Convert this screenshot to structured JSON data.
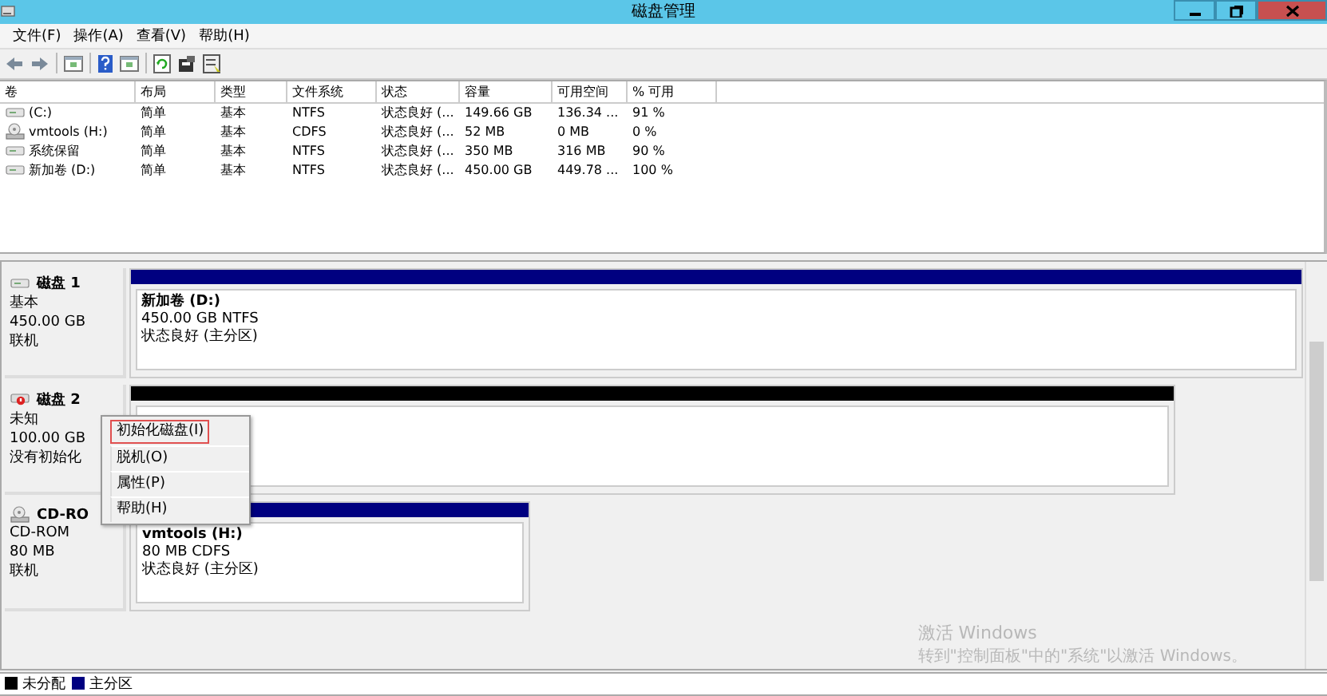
{
  "window": {
    "title": "磁盘管理"
  },
  "menu": [
    "文件(F)",
    "操作(A)",
    "查看(V)",
    "帮助(H)"
  ],
  "toolbar": [
    {
      "kind": "back"
    },
    {
      "kind": "forward"
    },
    {
      "kind": "sep"
    },
    {
      "kind": "panel"
    },
    {
      "kind": "sep"
    },
    {
      "kind": "help"
    },
    {
      "kind": "panel"
    },
    {
      "kind": "sep"
    },
    {
      "kind": "refresh"
    },
    {
      "kind": "properties"
    },
    {
      "kind": "wizard"
    }
  ],
  "volume_table": {
    "columns": [
      "卷",
      "布局",
      "类型",
      "文件系统",
      "状态",
      "容量",
      "可用空间",
      "% 可用"
    ],
    "rows": [
      {
        "kind": "disk",
        "cells": [
          "(C:)",
          "简单",
          "基本",
          "NTFS",
          "状态良好 (...",
          "149.66 GB",
          "136.34 ...",
          "91 %"
        ]
      },
      {
        "kind": "cdrom",
        "cells": [
          "vmtools (H:)",
          "简单",
          "基本",
          "CDFS",
          "状态良好 (...",
          "52 MB",
          "0 MB",
          "0 %"
        ]
      },
      {
        "kind": "disk",
        "cells": [
          "系统保留",
          "简单",
          "基本",
          "NTFS",
          "状态良好 (...",
          "350 MB",
          "316 MB",
          "90 %"
        ]
      },
      {
        "kind": "disk",
        "cells": [
          "新加卷 (D:)",
          "简单",
          "基本",
          "NTFS",
          "状态良好 (...",
          "450.00 GB",
          "449.78 ...",
          "100 %"
        ]
      }
    ]
  },
  "disks": [
    {
      "kind": "basic",
      "name": "磁盘 1",
      "lines": [
        "基本",
        "450.00 GB",
        "联机"
      ],
      "partition": {
        "kind": "primary",
        "title": "新加卷  (D:)",
        "lines": [
          "450.00 GB NTFS",
          "状态良好 (主分区)"
        ]
      }
    },
    {
      "kind": "unknown",
      "name": "磁盘 2",
      "lines": [
        "未知",
        "100.00 GB",
        "没有初始化"
      ],
      "partition": {
        "kind": "unallocated"
      }
    },
    {
      "kind": "cdrom",
      "name": "CD-RO",
      "lines": [
        "CD-ROM",
        "80 MB",
        "联机"
      ],
      "partition": {
        "kind": "primary",
        "title": "vmtools  (H:)",
        "lines": [
          "80 MB CDFS",
          "状态良好 (主分区)"
        ]
      }
    }
  ],
  "context_menu": [
    {
      "label": "初始化磁盘(I)",
      "selected": true
    },
    {
      "label": "脱机(O)",
      "selected": false
    },
    {
      "label": "属性(P)",
      "selected": false
    },
    {
      "label": "帮助(H)",
      "selected": false
    }
  ],
  "legend": [
    {
      "label": "未分配",
      "color": "#000000"
    },
    {
      "label": "主分区",
      "color": "#000080"
    }
  ],
  "activation": {
    "title": "激活 Windows",
    "text": "转到\"控制面板\"中的\"系统\"以激活 Windows。"
  }
}
